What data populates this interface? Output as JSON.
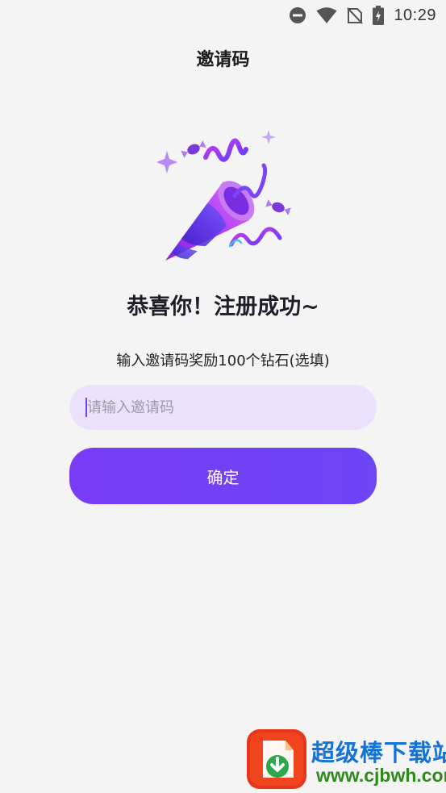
{
  "status_bar": {
    "time": "10:29",
    "icons": [
      "do-not-disturb-icon",
      "wifi-icon",
      "no-sim-icon",
      "battery-charging-icon"
    ]
  },
  "header": {
    "title": "邀请码"
  },
  "main": {
    "illustration": "party-popper-icon",
    "headline": "恭喜你！注册成功~",
    "subtitle": "输入邀请码奖励100个钻石(选填)",
    "invite_input": {
      "value": "",
      "placeholder": "请输入邀请码"
    },
    "confirm_label": "确定"
  },
  "watermark": {
    "title": "超级棒下载站",
    "url": "www.cjbwh.com"
  },
  "colors": {
    "background": "#f4f4f4",
    "accent": "#7a3cf6",
    "input_background": "#ece1fc"
  }
}
